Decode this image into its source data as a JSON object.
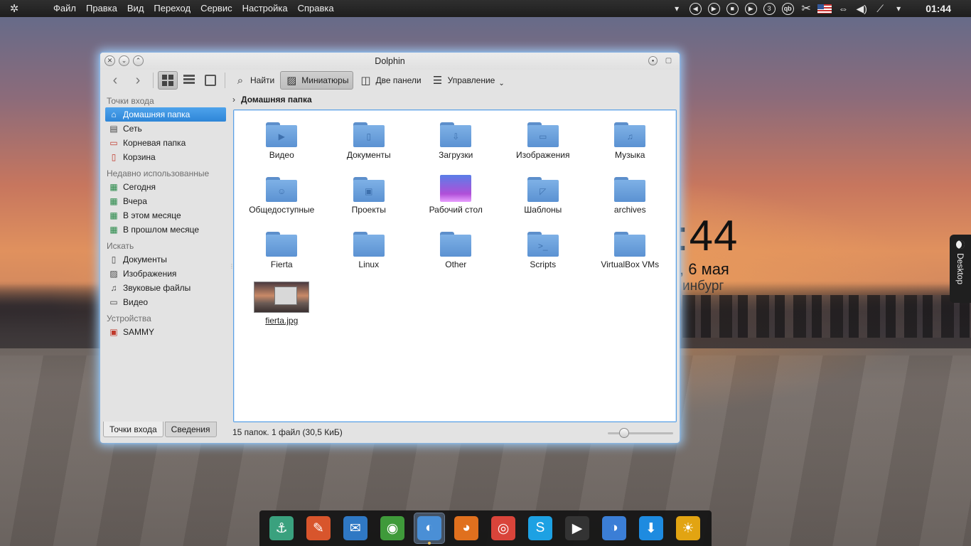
{
  "top_panel": {
    "menu": [
      "Файл",
      "Правка",
      "Вид",
      "Переход",
      "Сервис",
      "Настройка",
      "Справка"
    ],
    "tray_badge": "3",
    "tray_qb": "qb",
    "clock": "01:44"
  },
  "desktop_widget": {
    "time_fragment": ":44",
    "date_fragment": ", 6 мая",
    "city_fragment": "инбург"
  },
  "desktop_tab": {
    "label": "Desktop"
  },
  "window": {
    "title": "Dolphin",
    "toolbar": {
      "find": "Найти",
      "previews": "Миниатюры",
      "split": "Две панели",
      "control": "Управление"
    },
    "places": {
      "groups": [
        {
          "title": "Точки входа",
          "items": [
            {
              "label": "Домашняя папка",
              "icon": "home-icon",
              "selected": true
            },
            {
              "label": "Сеть",
              "icon": "network-icon"
            },
            {
              "label": "Корневая папка",
              "icon": "root-folder-icon"
            },
            {
              "label": "Корзина",
              "icon": "trash-icon"
            }
          ]
        },
        {
          "title": "Недавно использованные",
          "items": [
            {
              "label": "Сегодня",
              "icon": "calendar-icon"
            },
            {
              "label": "Вчера",
              "icon": "calendar-icon"
            },
            {
              "label": "В этом месяце",
              "icon": "calendar-icon"
            },
            {
              "label": "В прошлом месяце",
              "icon": "calendar-icon"
            }
          ]
        },
        {
          "title": "Искать",
          "items": [
            {
              "label": "Документы",
              "icon": "document-icon"
            },
            {
              "label": "Изображения",
              "icon": "image-icon"
            },
            {
              "label": "Звуковые файлы",
              "icon": "audio-icon"
            },
            {
              "label": "Видео",
              "icon": "video-icon"
            }
          ]
        },
        {
          "title": "Устройства",
          "items": [
            {
              "label": "SAMMY",
              "icon": "usb-drive-icon"
            }
          ]
        }
      ]
    },
    "panel_tabs": {
      "places": "Точки входа",
      "info": "Сведения"
    },
    "breadcrumb": "Домашняя папка",
    "files": [
      {
        "name": "Видео",
        "kind": "folder",
        "emblem": "▶"
      },
      {
        "name": "Документы",
        "kind": "folder",
        "emblem": "▯"
      },
      {
        "name": "Загрузки",
        "kind": "folder",
        "emblem": "⇩"
      },
      {
        "name": "Изображения",
        "kind": "folder",
        "emblem": "▭"
      },
      {
        "name": "Музыка",
        "kind": "folder",
        "emblem": "♫"
      },
      {
        "name": "Общедоступные",
        "kind": "folder",
        "emblem": "☺"
      },
      {
        "name": "Проекты",
        "kind": "folder",
        "emblem": "▣"
      },
      {
        "name": "Рабочий стол",
        "kind": "desktop"
      },
      {
        "name": "Шаблоны",
        "kind": "folder",
        "emblem": "◸"
      },
      {
        "name": "archives",
        "kind": "folder",
        "emblem": ""
      },
      {
        "name": "Fierta",
        "kind": "folder",
        "emblem": ""
      },
      {
        "name": "Linux",
        "kind": "folder",
        "emblem": ""
      },
      {
        "name": "Other",
        "kind": "folder",
        "emblem": ""
      },
      {
        "name": "Scripts",
        "kind": "folder",
        "emblem": ">_"
      },
      {
        "name": "VirtualBox VMs",
        "kind": "folder",
        "emblem": ""
      },
      {
        "name": "fierta.jpg",
        "kind": "image"
      }
    ],
    "status": "15 папок. 1 файл (30,5 КиБ)",
    "zoom_level": 0.2
  },
  "dock": {
    "items": [
      {
        "name": "anchor-app-icon",
        "glyph": "⚓",
        "color": "#3aa17e"
      },
      {
        "name": "paint-app-icon",
        "glyph": "✎",
        "color": "#d8552c"
      },
      {
        "name": "mail-app-icon",
        "glyph": "✉",
        "color": "#2f78c4"
      },
      {
        "name": "rss-app-icon",
        "glyph": "◉",
        "color": "#3f9a3a"
      },
      {
        "name": "dolphin-app-icon",
        "glyph": "◐",
        "color": "#4a8fd6",
        "active": true
      },
      {
        "name": "firefox-app-icon",
        "glyph": "◕",
        "color": "#e0701e"
      },
      {
        "name": "chrome-app-icon",
        "glyph": "◎",
        "color": "#d9443a"
      },
      {
        "name": "skype-app-icon",
        "glyph": "S",
        "color": "#1da1e3"
      },
      {
        "name": "media-player-app-icon",
        "glyph": "▶",
        "color": "#333333"
      },
      {
        "name": "toggle-app-icon",
        "glyph": "◑",
        "color": "#3b7ed6"
      },
      {
        "name": "download-app-icon",
        "glyph": "⬇",
        "color": "#1e8be0"
      },
      {
        "name": "weather-app-icon",
        "glyph": "☀",
        "color": "#e2a412"
      }
    ]
  }
}
